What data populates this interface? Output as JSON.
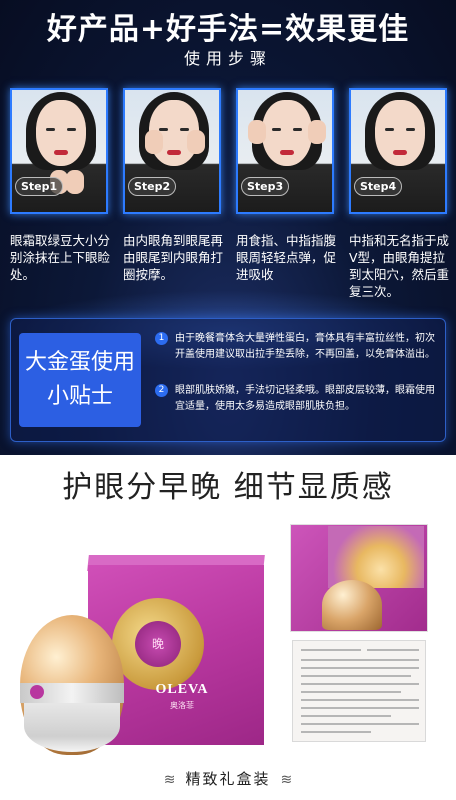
{
  "top": {
    "headline": "好产品+好手法=效果更佳",
    "subheadline": "使用步骤",
    "steps": [
      {
        "label": "Step1",
        "text": "眼霜取绿豆大小分别涂抹在上下眼睑处。"
      },
      {
        "label": "Step2",
        "text": "由内眼角到眼尾再由眼尾到内眼角打圈按摩。"
      },
      {
        "label": "Step3",
        "text": "用食指、中指指腹眼周轻轻点弹，促进吸收"
      },
      {
        "label": "Step4",
        "text": "中指和无名指于成V型，由眼角提拉到太阳穴，然后重复三次。"
      }
    ]
  },
  "tips": {
    "badge": "大金蛋使用小贴士",
    "items": [
      {
        "num": "1",
        "text": "由于晚餐膏体含大量弹性蛋白，膏体具有丰富拉丝性，初次开盖使用建议取出拉手垫丢除，不再回盖，以免膏体溢出。"
      },
      {
        "num": "2",
        "text": "眼部肌肤娇嫩，手法切记轻柔哦。眼部皮层较薄，眼霜使用宜适量，使用太多易造成眼部肌肤负担。"
      }
    ]
  },
  "bottom": {
    "headline": "护眼分早晚  细节显质感",
    "brand": "OLEVA",
    "brand_cn": "奥洛菲",
    "emblem_text": "晚",
    "caption": "精致礼盒装"
  },
  "colors": {
    "step_border": "#2d7bff",
    "tips_badge": "#2c5fe3",
    "box_purple": "#b8379f",
    "gold": "#c99a3c"
  }
}
